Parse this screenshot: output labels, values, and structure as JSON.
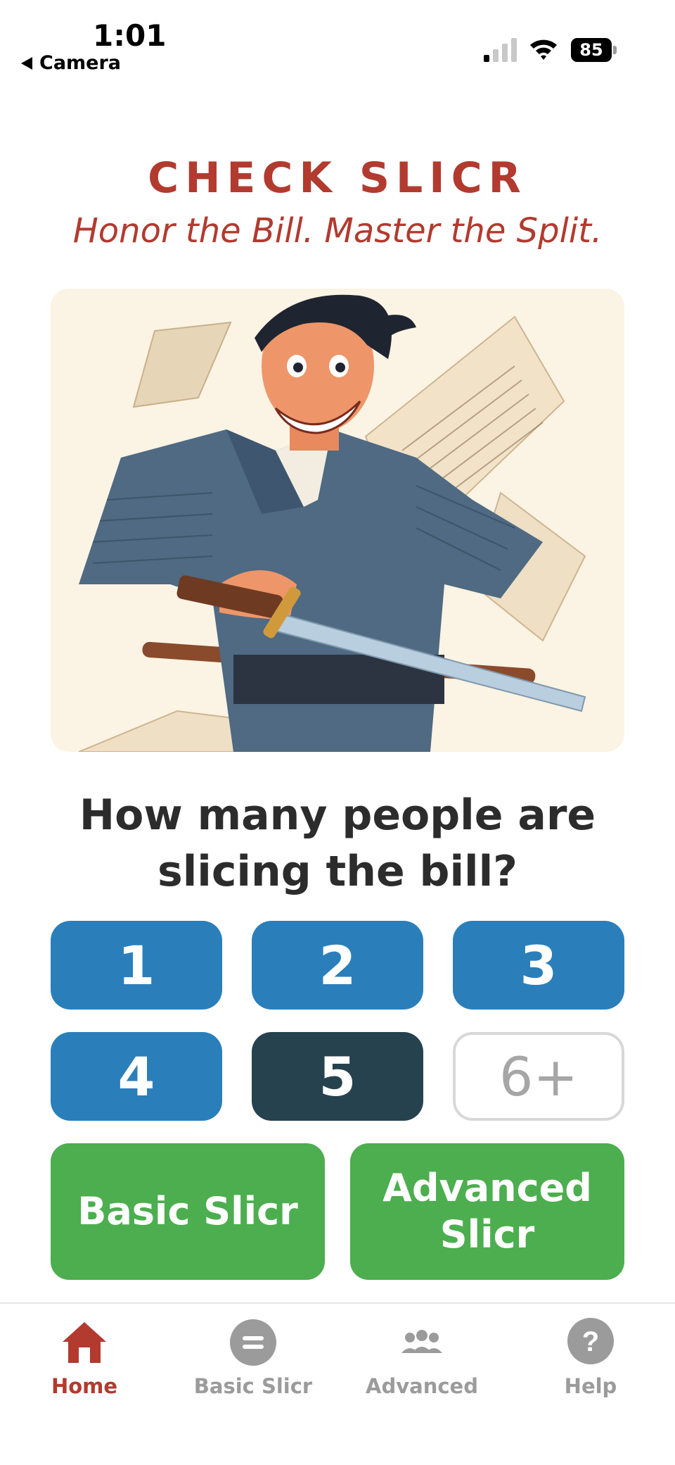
{
  "status": {
    "time": "1:01",
    "back_label": "Camera",
    "battery": "85"
  },
  "header": {
    "title": "CHECK SLICR",
    "tagline": "Honor the Bill. Master the Split."
  },
  "hero": {
    "image": "samurai-slicing-receipts-illustration"
  },
  "question": "How many people are slicing the bill?",
  "people_options": [
    "1",
    "2",
    "3",
    "4",
    "5",
    "6+"
  ],
  "selected_option": "5",
  "actions": {
    "basic": "Basic Slicr",
    "advanced": "Advanced Slicr"
  },
  "tabs": [
    {
      "label": "Home",
      "icon": "home-icon",
      "active": true
    },
    {
      "label": "Basic Slicr",
      "icon": "equals-icon",
      "active": false
    },
    {
      "label": "Advanced",
      "icon": "group-icon",
      "active": false
    },
    {
      "label": "Help",
      "icon": "help-icon",
      "active": false
    }
  ],
  "colors": {
    "brand_red": "#b23a2f",
    "button_blue": "#2a7fba",
    "selected_dark": "#26424f",
    "action_green": "#4cae4f",
    "muted": "#9b9b9b"
  }
}
